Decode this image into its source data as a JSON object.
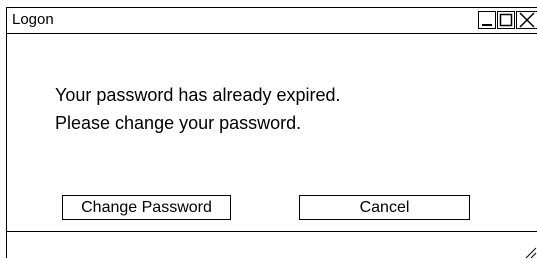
{
  "window": {
    "title": "Logon"
  },
  "controls": {
    "minimize_icon": "minimize-icon",
    "maximize_icon": "maximize-icon",
    "close_icon": "close-icon"
  },
  "message": {
    "line1": "Your password has already expired.",
    "line2": "Please change your password."
  },
  "buttons": {
    "change_password": "Change Password",
    "cancel": "Cancel"
  },
  "statusbar": {
    "text": "",
    "grip_icon": "resize-grip-icon"
  }
}
